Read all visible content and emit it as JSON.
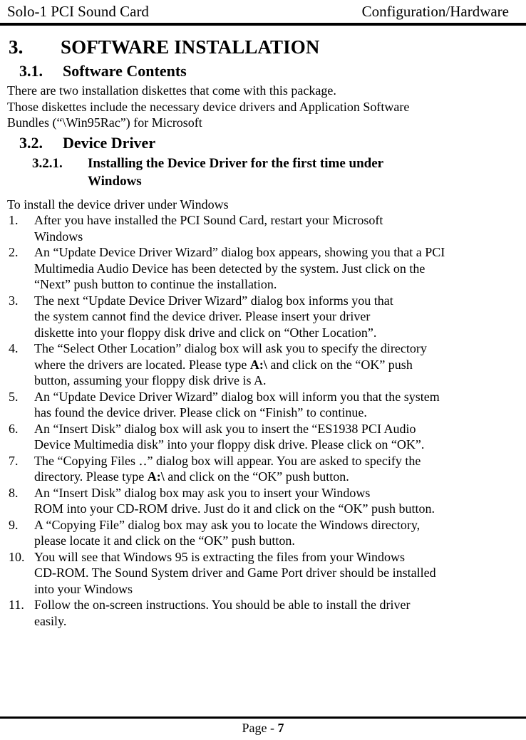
{
  "header": {
    "left": "Solo-1 PCI Sound Card",
    "right": "Configuration/Hardware"
  },
  "footer": {
    "label": "Page - ",
    "page_number": "7"
  },
  "sections": {
    "h1_num": "3.",
    "h1_title": "SOFTWARE INSTALLATION",
    "h2_1_num": "3.1.",
    "h2_1_title": "Software Contents",
    "h2_2_num": "3.2.",
    "h2_2_title": "Device Driver",
    "h3_1_num": "3.2.1.",
    "h3_1_title": "Installing the Device Driver for the first time under",
    "h3_1_title_cont": "Windows"
  },
  "paragraphs": {
    "intro_1": "There are two installation diskettes that come with this package.",
    "intro_2": "Those diskettes include the necessary device drivers and Application Software",
    "intro_3": "Bundles (“\\Win95Rac”) for Microsoft",
    "lead_in": "To install the device driver under Windows"
  },
  "steps": [
    {
      "marker": "1.",
      "lines": [
        "After you have installed the PCI Sound Card, restart your Microsoft",
        "Windows"
      ]
    },
    {
      "marker": "2.",
      "lines": [
        "An “Update Device Driver Wizard” dialog box appears, showing you that a PCI",
        "Multimedia Audio Device has been detected by the system. Just click on the",
        "“Next” push button to continue the installation."
      ]
    },
    {
      "marker": "3.",
      "lines": [
        "The next “Update Device Driver Wizard” dialog box informs you that",
        "the system cannot find the device driver. Please insert your driver",
        "diskette into your floppy disk drive and click on “Other Location”."
      ]
    },
    {
      "marker": "4.",
      "lines": [
        "The “Select Other Location” dialog box will ask you to specify the directory",
        "where the drivers are located. Please type ||A:\\|| and click on the “OK” push",
        "button, assuming your floppy disk drive is A."
      ]
    },
    {
      "marker": "5.",
      "lines": [
        "An “Update Device Driver Wizard” dialog box will inform you that the system",
        "has found the device driver. Please click on “Finish” to continue."
      ]
    },
    {
      "marker": "6.",
      "lines": [
        "An “Insert Disk” dialog box will ask you to insert the “ES1938 PCI Audio",
        "Device Multimedia disk” into your floppy disk drive. Please click on “OK”."
      ]
    },
    {
      "marker": "7.",
      "lines": [
        "The “Copying Files ‥” dialog box will appear. You are asked to specify the",
        "directory. Please type ||A:\\|| and click on the “OK” push button."
      ]
    },
    {
      "marker": "8.",
      "lines": [
        "An “Insert Disk” dialog box may ask you to insert your Windows",
        "ROM into your CD-ROM drive. Just do it and click on the “OK” push button."
      ]
    },
    {
      "marker": "9.",
      "lines": [
        "A “Copying File” dialog box may ask you to locate the Windows directory,",
        "please locate it and click on the “OK” push button."
      ]
    },
    {
      "marker": "10.",
      "lines": [
        "You will see that Windows 95 is extracting the files from your Windows",
        "CD-ROM. The Sound System driver and Game Port driver should be installed",
        "into your Windows"
      ]
    },
    {
      "marker": "11.",
      "lines": [
        "Follow the on-screen instructions. You should be able to install the driver",
        "easily."
      ]
    }
  ]
}
